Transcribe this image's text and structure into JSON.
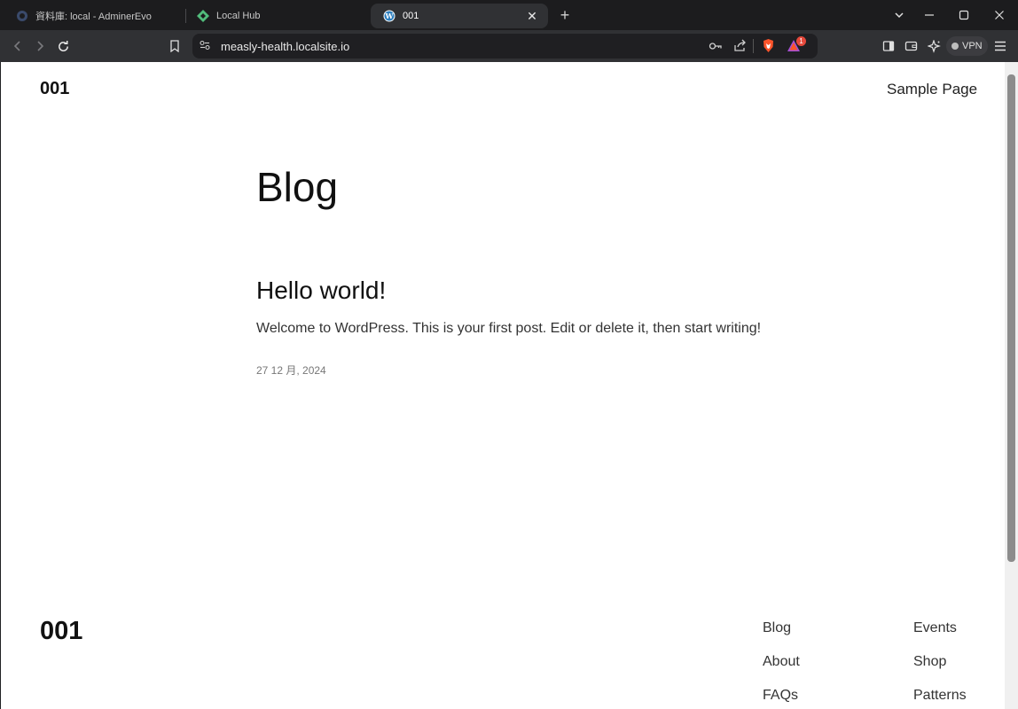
{
  "browser": {
    "tabs": [
      {
        "label": "資料庫: local - AdminerEvo",
        "active": false
      },
      {
        "label": "Local Hub",
        "active": false
      },
      {
        "label": "001",
        "active": true
      }
    ],
    "url": "measly-health.localsite.io",
    "vpn_label": "VPN",
    "notification_count": "1"
  },
  "page": {
    "site_title": "001",
    "nav": {
      "sample_page": "Sample Page"
    },
    "blog_heading": "Blog",
    "post": {
      "title": "Hello world!",
      "excerpt": "Welcome to WordPress. This is your first post. Edit or delete it, then start writing!",
      "date": "27 12 月, 2024"
    },
    "footer": {
      "site_title": "001",
      "col1": [
        "Blog",
        "About",
        "FAQs"
      ],
      "col2": [
        "Events",
        "Shop",
        "Patterns"
      ]
    }
  },
  "colors": {
    "accent_brave": "#fb542b",
    "wp_blue": "#2d7fbf",
    "local_green": "#51bb7b"
  }
}
